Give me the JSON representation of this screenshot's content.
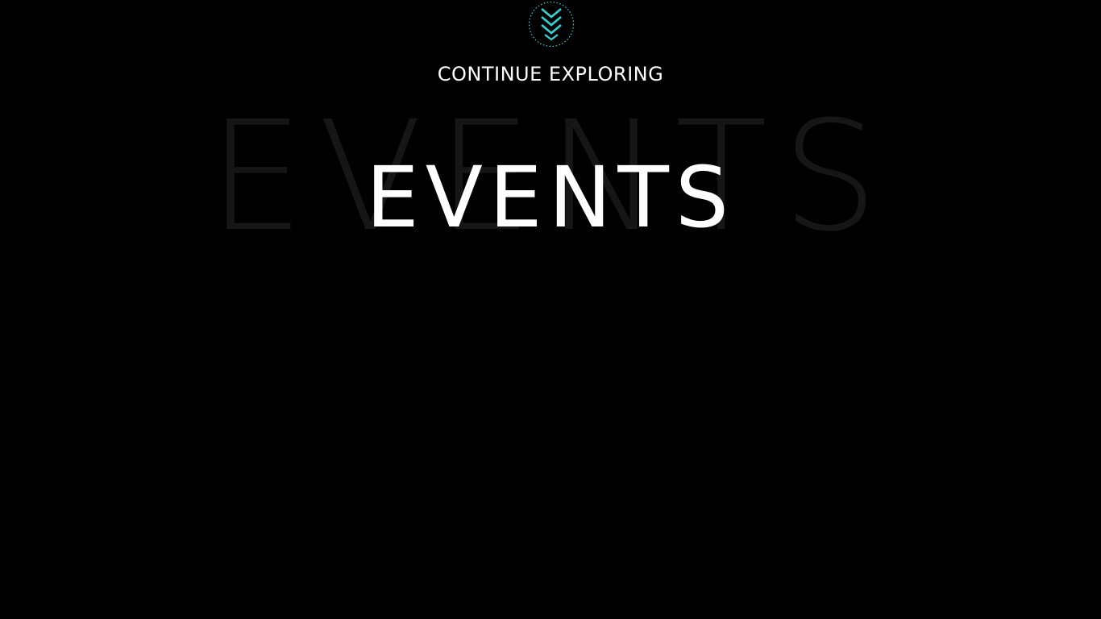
{
  "scroll_cta": {
    "icon": "chevrons-down-icon",
    "label": "CONTINUE EXPLORING",
    "accent_color": "#2fd3d6"
  },
  "events": {
    "ghost_text": "EVENTS",
    "title": "EVENTS"
  }
}
